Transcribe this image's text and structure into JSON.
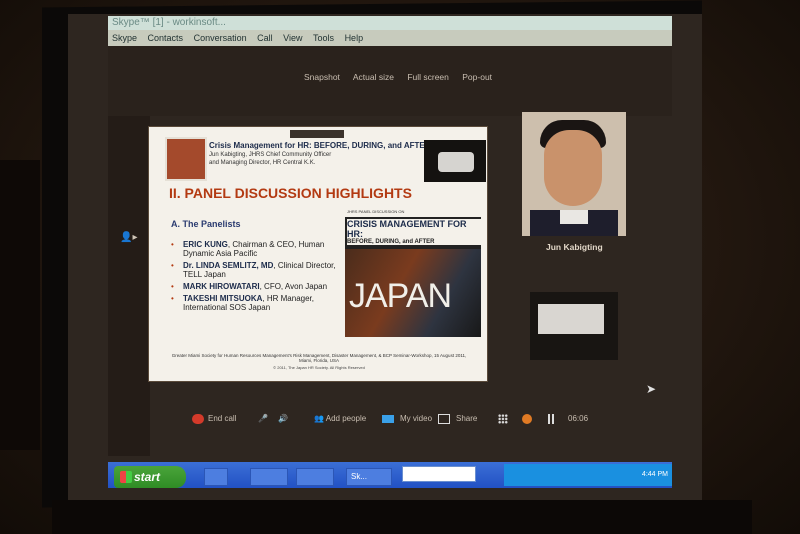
{
  "window": {
    "title": "Skype™ [1] - workinsoft..."
  },
  "menu": [
    "Skype",
    "Contacts",
    "Conversation",
    "Call",
    "View",
    "Tools",
    "Help"
  ],
  "toolbar": [
    "Snapshot",
    "Actual size",
    "Full screen",
    "Pop-out"
  ],
  "slide": {
    "header": "Crisis Management for HR: BEFORE, DURING, and AFTER",
    "subheader1": "Jun Kabigting, JHRS Chief Community Officer",
    "subheader2": "and Managing Director, HR Central K.K.",
    "heading": "II. PANEL DISCUSSION HIGHLIGHTS",
    "section": "A. The Panelists",
    "panelists": [
      {
        "name": "ERIC KUNG",
        "role": ", Chairman & CEO, Human Dynamic Asia Pacific"
      },
      {
        "name": "Dr. LINDA SEMLITZ, MD",
        "role": ", Clinical Director, TELL Japan"
      },
      {
        "name": "MARK HIROWATARI",
        "role": ", CFO, Avon Japan"
      },
      {
        "name": "TAKESHI MITSUOKA",
        "role": ", HR Manager, International SOS Japan"
      }
    ],
    "poster_kicker": "JHRS PANEL DISCUSSION ON",
    "poster_title": "CRISIS MANAGEMENT FOR HR:",
    "poster_sub": "BEFORE, DURING, and AFTER",
    "poster_word": "JAPAN",
    "footer1": "Greater Miami Society for Human Resources Management's Risk Management, Disaster Management, & BCP Seminar-Workshop, 15 August 2011, Miami, Florida, USA",
    "footer2": "© 2011, The Japan HR Society. All Rights Reserved"
  },
  "participant": {
    "name": "Jun Kabigting"
  },
  "controls": {
    "end_call": "End call",
    "add_people": "Add people",
    "my_video": "My video",
    "share": "Share",
    "timer": "06:06"
  },
  "taskbar": {
    "start": "start",
    "skype_item": "Sk...",
    "clock": "4:44 PM"
  }
}
